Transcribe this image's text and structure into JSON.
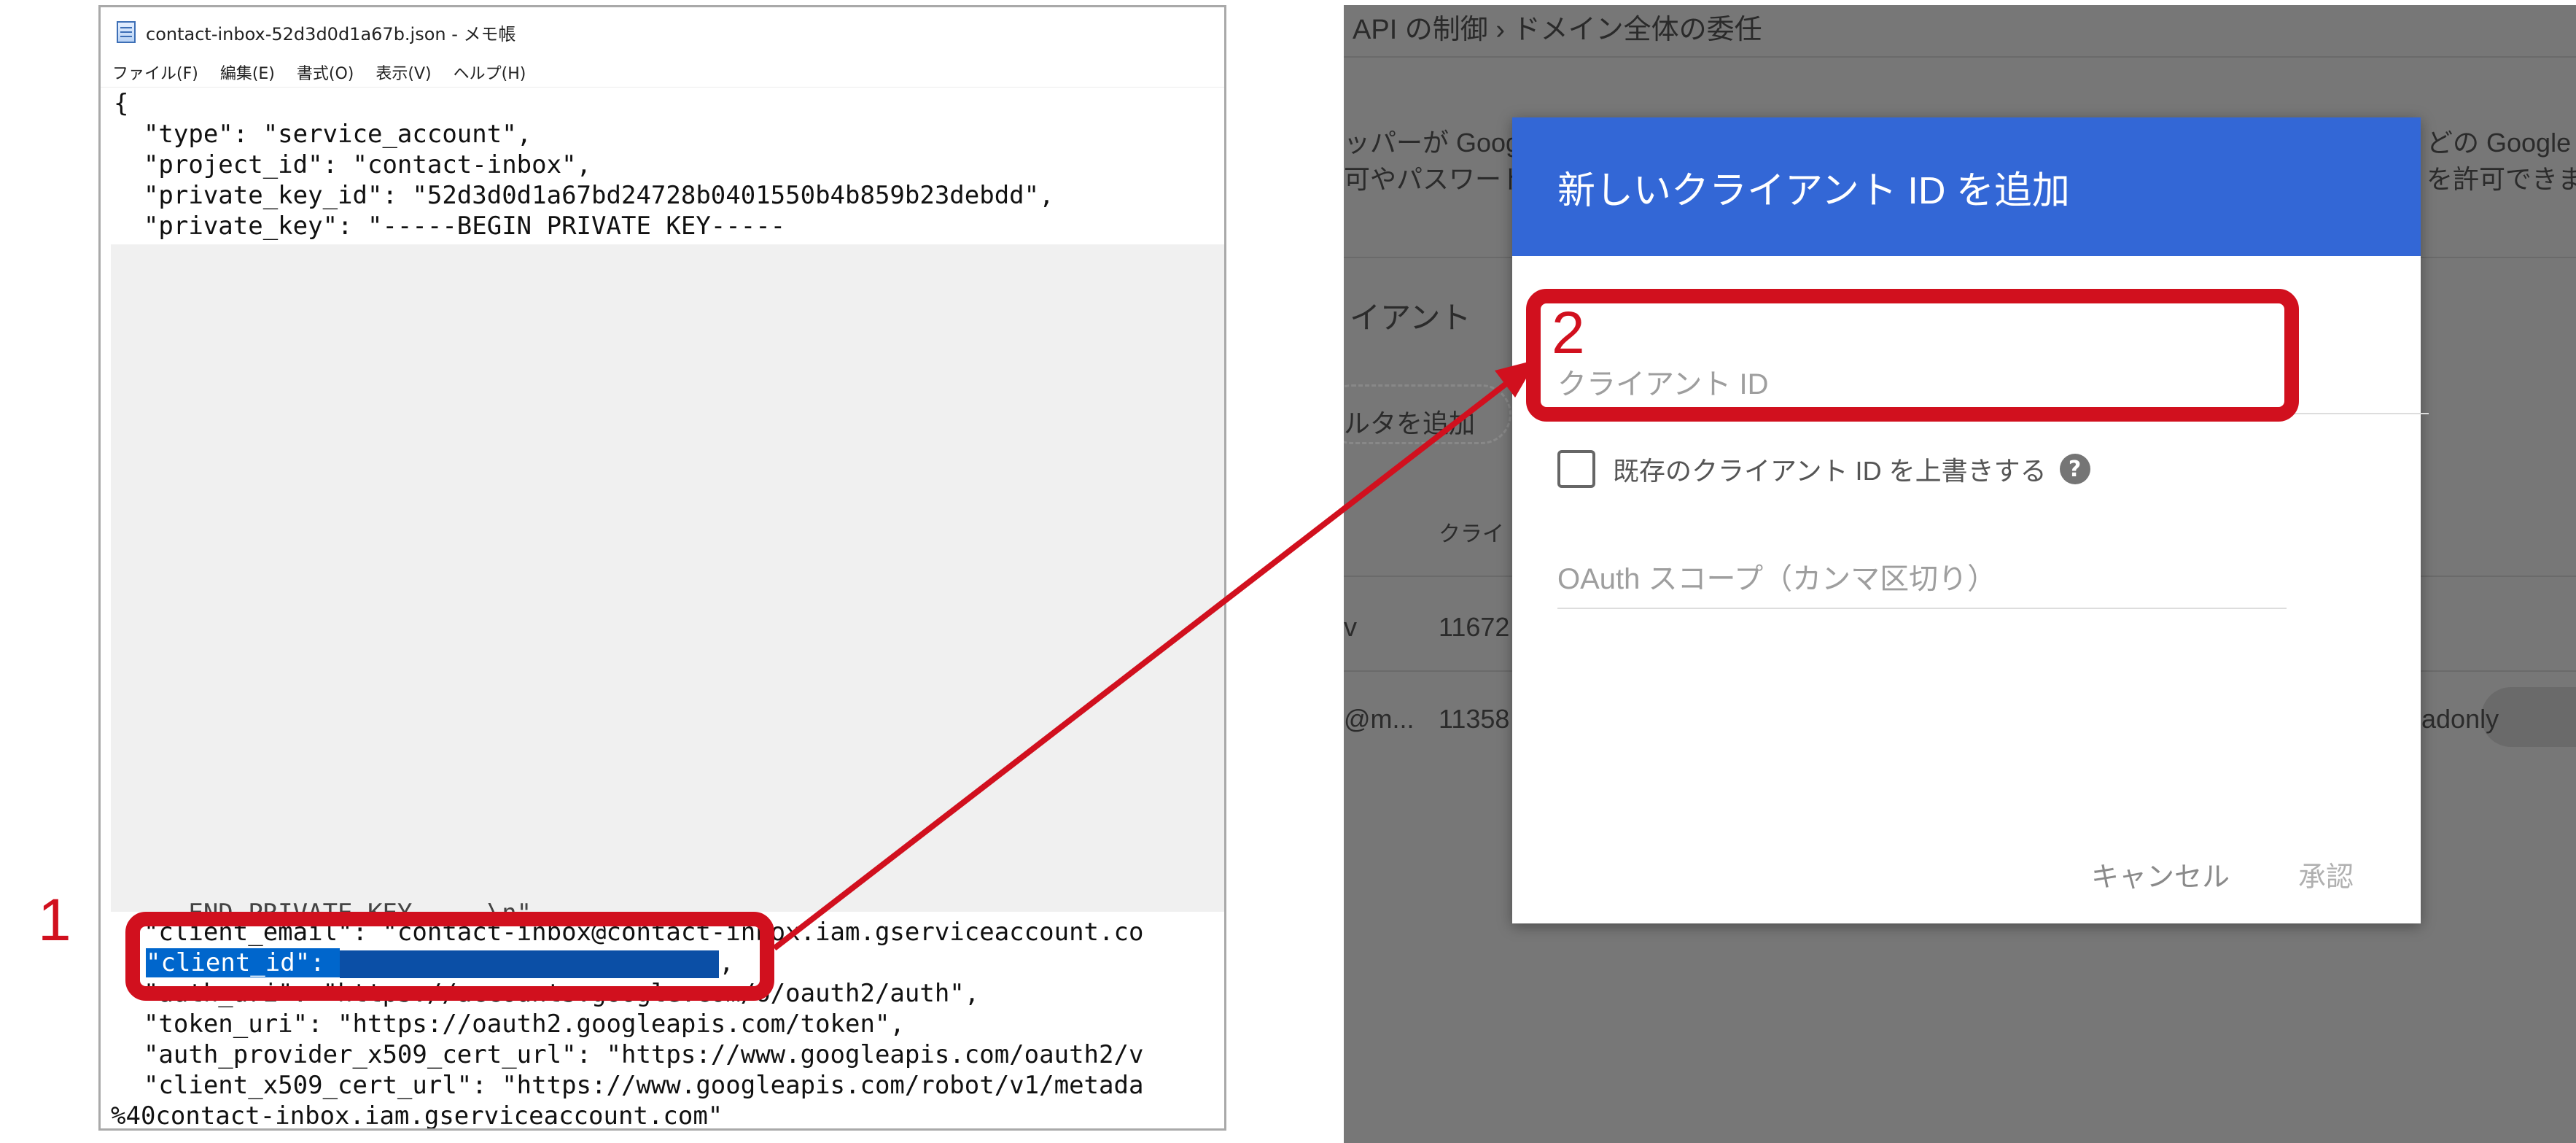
{
  "notepad": {
    "title": "contact-inbox-52d3d0d1a67b.json - メモ帳",
    "menu": [
      "ファイル(F)",
      "編集(E)",
      "書式(O)",
      "表示(V)",
      "ヘルプ(H)"
    ],
    "lines": {
      "open_brace": "{",
      "type": "  \"type\": \"service_account\",",
      "project_id": "  \"project_id\": \"contact-inbox\",",
      "private_key_id": "  \"private_key_id\": \"52d3d0d1a67bd24728b0401550b4b859b23debdd\",",
      "private_key": "  \"private_key\": \"-----BEGIN PRIVATE KEY-----",
      "key_tail": "  ...END PRIVATE KEY-----\\n\",",
      "client_email": "  \"client_email\": \"contact-inbox@contact-inbox.iam.gserviceaccount.co",
      "client_id_selected": "\"client_id\": ",
      "client_id_comma": ",",
      "auth_uri": "  \"auth_uri\": \"https://accounts.google.com/o/oauth2/auth\",",
      "token_uri": "  \"token_uri\": \"https://oauth2.googleapis.com/token\",",
      "auth_provider": "  \"auth_provider_x509_cert_url\": \"https://www.googleapis.com/oauth2/v",
      "client_cert": "  \"client_x509_cert_url\": \"https://www.googleapis.com/robot/v1/metada",
      "last": "%40contact-inbox.iam.gserviceaccount.com\""
    }
  },
  "console": {
    "breadcrumb": "API の制御  ›  ドメイン全体の委任",
    "desc_left_1": "ッパーが Googl",
    "desc_left_2": "可やパスワード",
    "desc_right_1": "どの Google",
    "desc_right_2": "を許可できま",
    "section": "イアント",
    "filter_chip": "ルタを追加",
    "col_header": "クライ",
    "row1_name": "v",
    "row1_id": "11672",
    "row2_name": "@m...",
    "row2_id": "11358",
    "row2_scope": "adonly"
  },
  "dialog": {
    "title": "新しいクライアント ID を追加",
    "client_id_placeholder": "クライアント ID",
    "overwrite_label": "既存のクライアント ID を上書きする",
    "scope_placeholder": "OAuth スコープ（カンマ区切り）",
    "cancel_label": "キャンセル",
    "approve_label": "承認"
  },
  "annotations": {
    "step1": "1",
    "step2": "2",
    "color": "#d1101e"
  },
  "colors": {
    "dialog_header": "#3367d6",
    "selection": "#0066cc",
    "overlay": "#777777"
  }
}
